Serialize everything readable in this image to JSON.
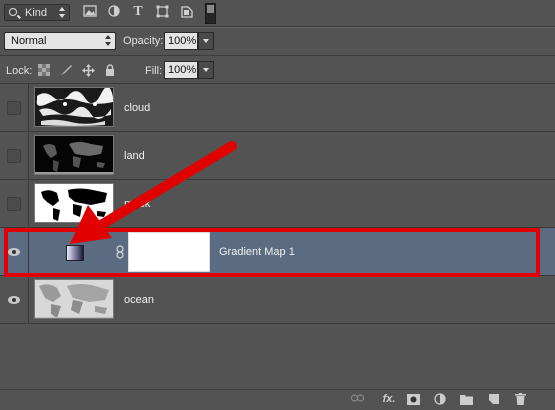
{
  "filter": {
    "kind_label": "Kind",
    "icons": [
      "search-icon",
      "image-filter-icon",
      "adjustment-filter-icon",
      "type-filter-icon",
      "shape-filter-icon",
      "smart-object-filter-icon"
    ]
  },
  "blend": {
    "mode": "Normal",
    "opacity_label": "Opacity:",
    "opacity_value": "100%",
    "lock_label": "Lock:",
    "fill_label": "Fill:",
    "fill_value": "100%"
  },
  "layers": [
    {
      "name": "cloud",
      "visible": false
    },
    {
      "name": "land",
      "visible": false
    },
    {
      "name": "mask",
      "visible": false
    },
    {
      "name": "Gradient Map 1",
      "visible": true,
      "selected": true
    },
    {
      "name": "ocean",
      "visible": true
    }
  ],
  "annotation": {
    "color": "#e10000"
  },
  "bottom_icons": [
    "link-layers-icon",
    "fx-icon",
    "add-mask-icon",
    "new-adjustment-icon",
    "new-group-icon",
    "new-layer-icon",
    "delete-icon"
  ],
  "bottom": {
    "fx_label": "fx."
  }
}
